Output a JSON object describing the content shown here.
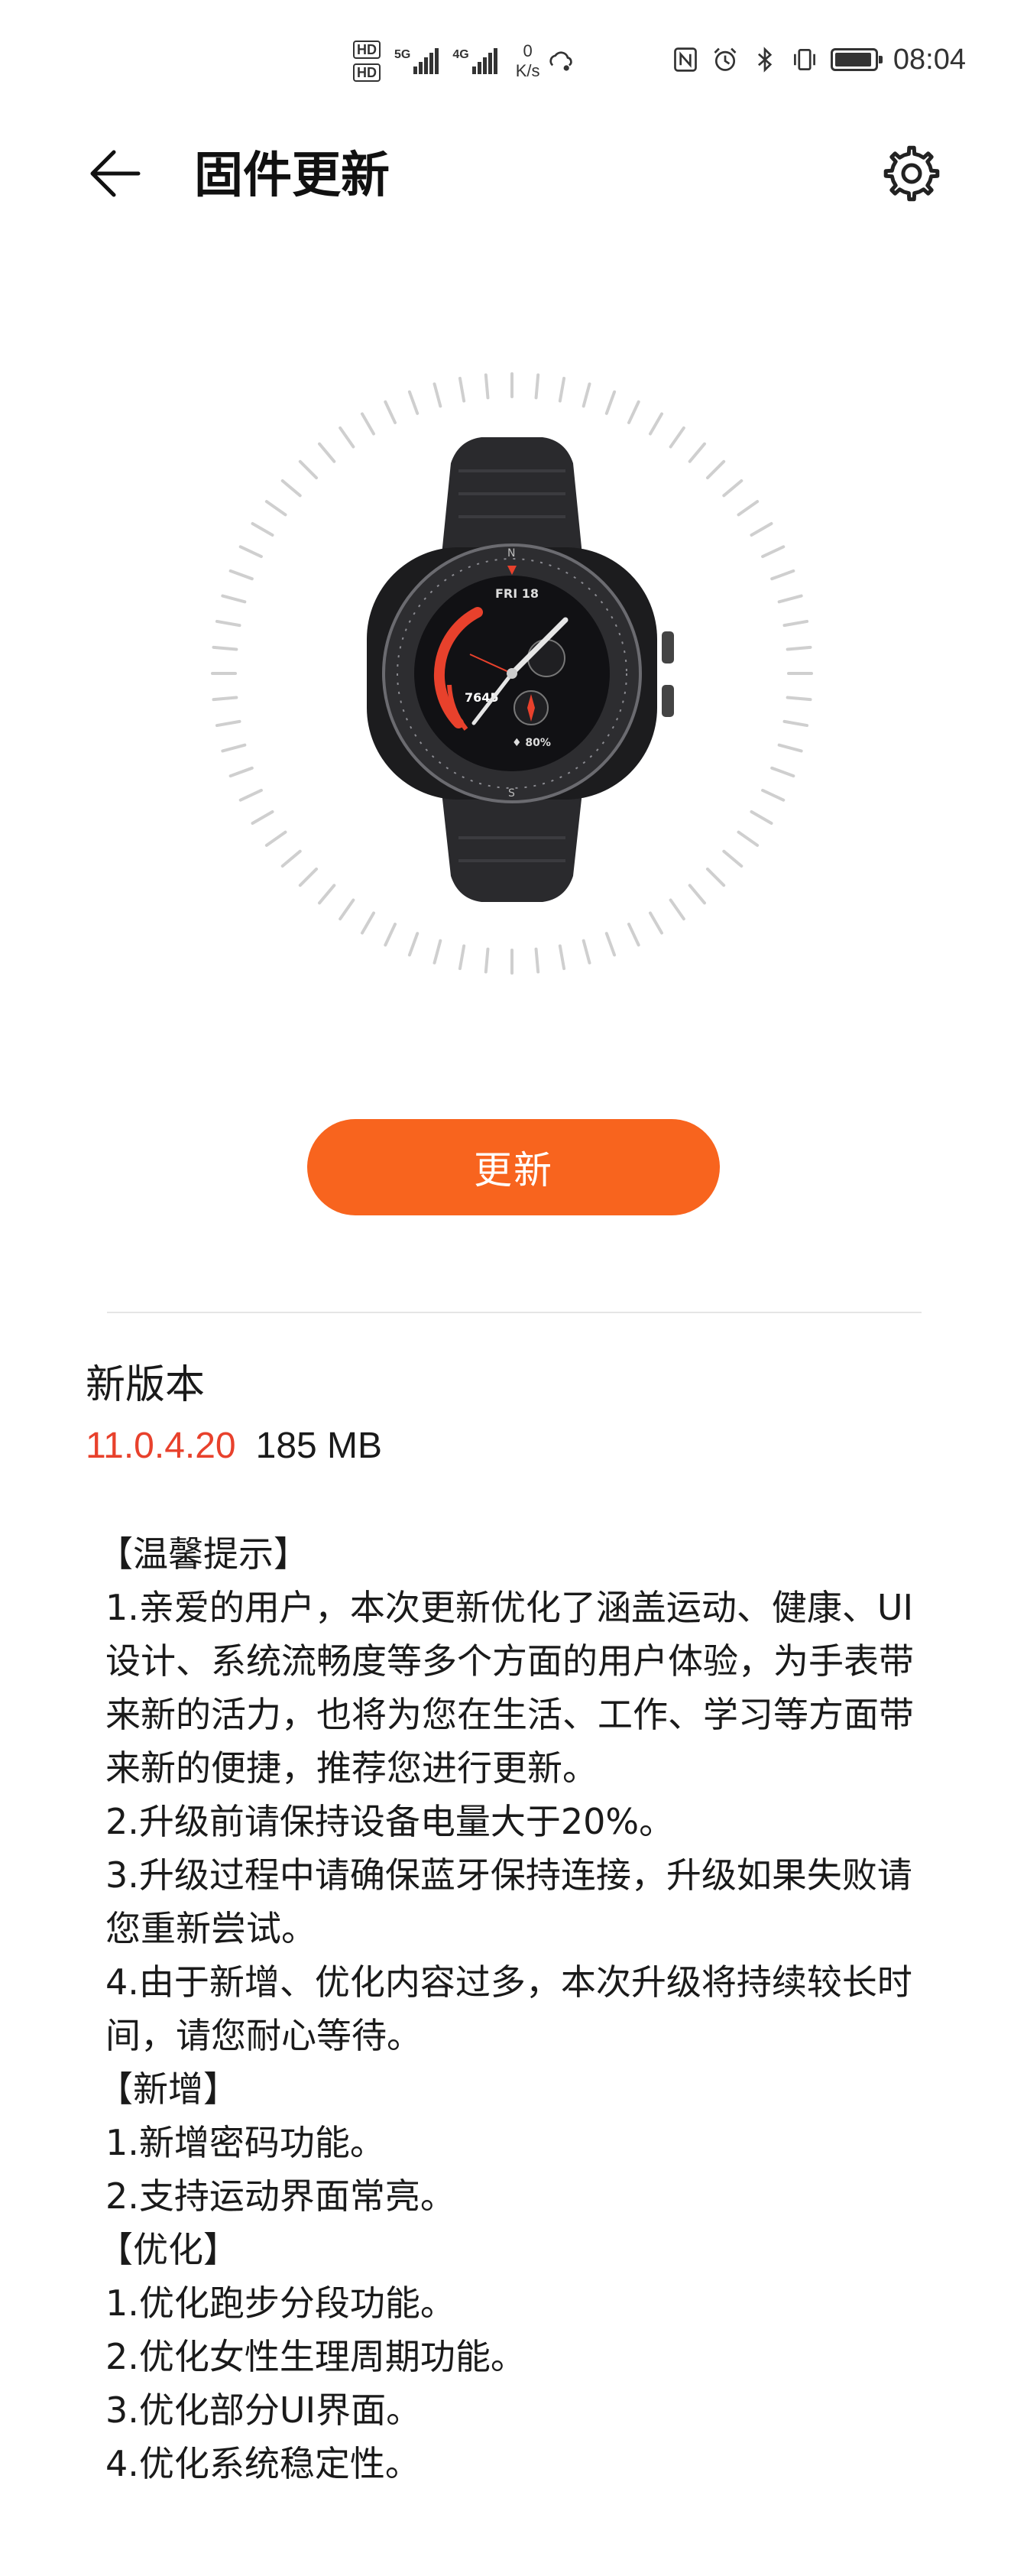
{
  "status_bar": {
    "sim1_badge": "HD",
    "sim2_badge": "HD",
    "net1_label": "5G",
    "net2_label": "4G",
    "speed_value": "0",
    "speed_unit": "K/s",
    "time": "08:04",
    "battery_level_percent": 95
  },
  "app_bar": {
    "title": "固件更新",
    "back_icon": "arrow-left-icon",
    "settings_icon": "gear-icon"
  },
  "hero": {
    "image": "smartwatch",
    "watch_date": "FRI 18",
    "watch_steps": "7645",
    "watch_battery": "♦ 80%",
    "compass_n": "N",
    "compass_s": "S"
  },
  "action": {
    "update_label": "更新"
  },
  "version": {
    "heading": "新版本",
    "number": "11.0.4.20",
    "size": "185 MB"
  },
  "release_notes": [
    {
      "type": "section",
      "text": "【温馨提示】"
    },
    {
      "type": "item",
      "text": "1.亲爱的用户，本次更新优化了涵盖运动、健康、UI设计、系统流畅度等多个方面的用户体验，为手表带来新的活力，也将为您在生活、工作、学习等方面带来新的便捷，推荐您进行更新。"
    },
    {
      "type": "item",
      "text": "2.升级前请保持设备电量大于20%。"
    },
    {
      "type": "item",
      "text": "3.升级过程中请确保蓝牙保持连接，升级如果失败请您重新尝试。"
    },
    {
      "type": "item",
      "text": "4.由于新增、优化内容过多，本次升级将持续较长时间，请您耐心等待。"
    },
    {
      "type": "section",
      "text": "【新增】"
    },
    {
      "type": "item",
      "text": "1.新增密码功能。"
    },
    {
      "type": "item",
      "text": "2.支持运动界面常亮。"
    },
    {
      "type": "section",
      "text": "【优化】"
    },
    {
      "type": "item",
      "text": "1.优化跑步分段功能。"
    },
    {
      "type": "item",
      "text": "2.优化女性生理周期功能。"
    },
    {
      "type": "item",
      "text": "3.优化部分UI界面。"
    },
    {
      "type": "item",
      "text": "4.优化系统稳定性。"
    }
  ],
  "colors": {
    "accent": "#f8641e",
    "version_number": "#e8412c",
    "divider": "#e5e5e5"
  }
}
